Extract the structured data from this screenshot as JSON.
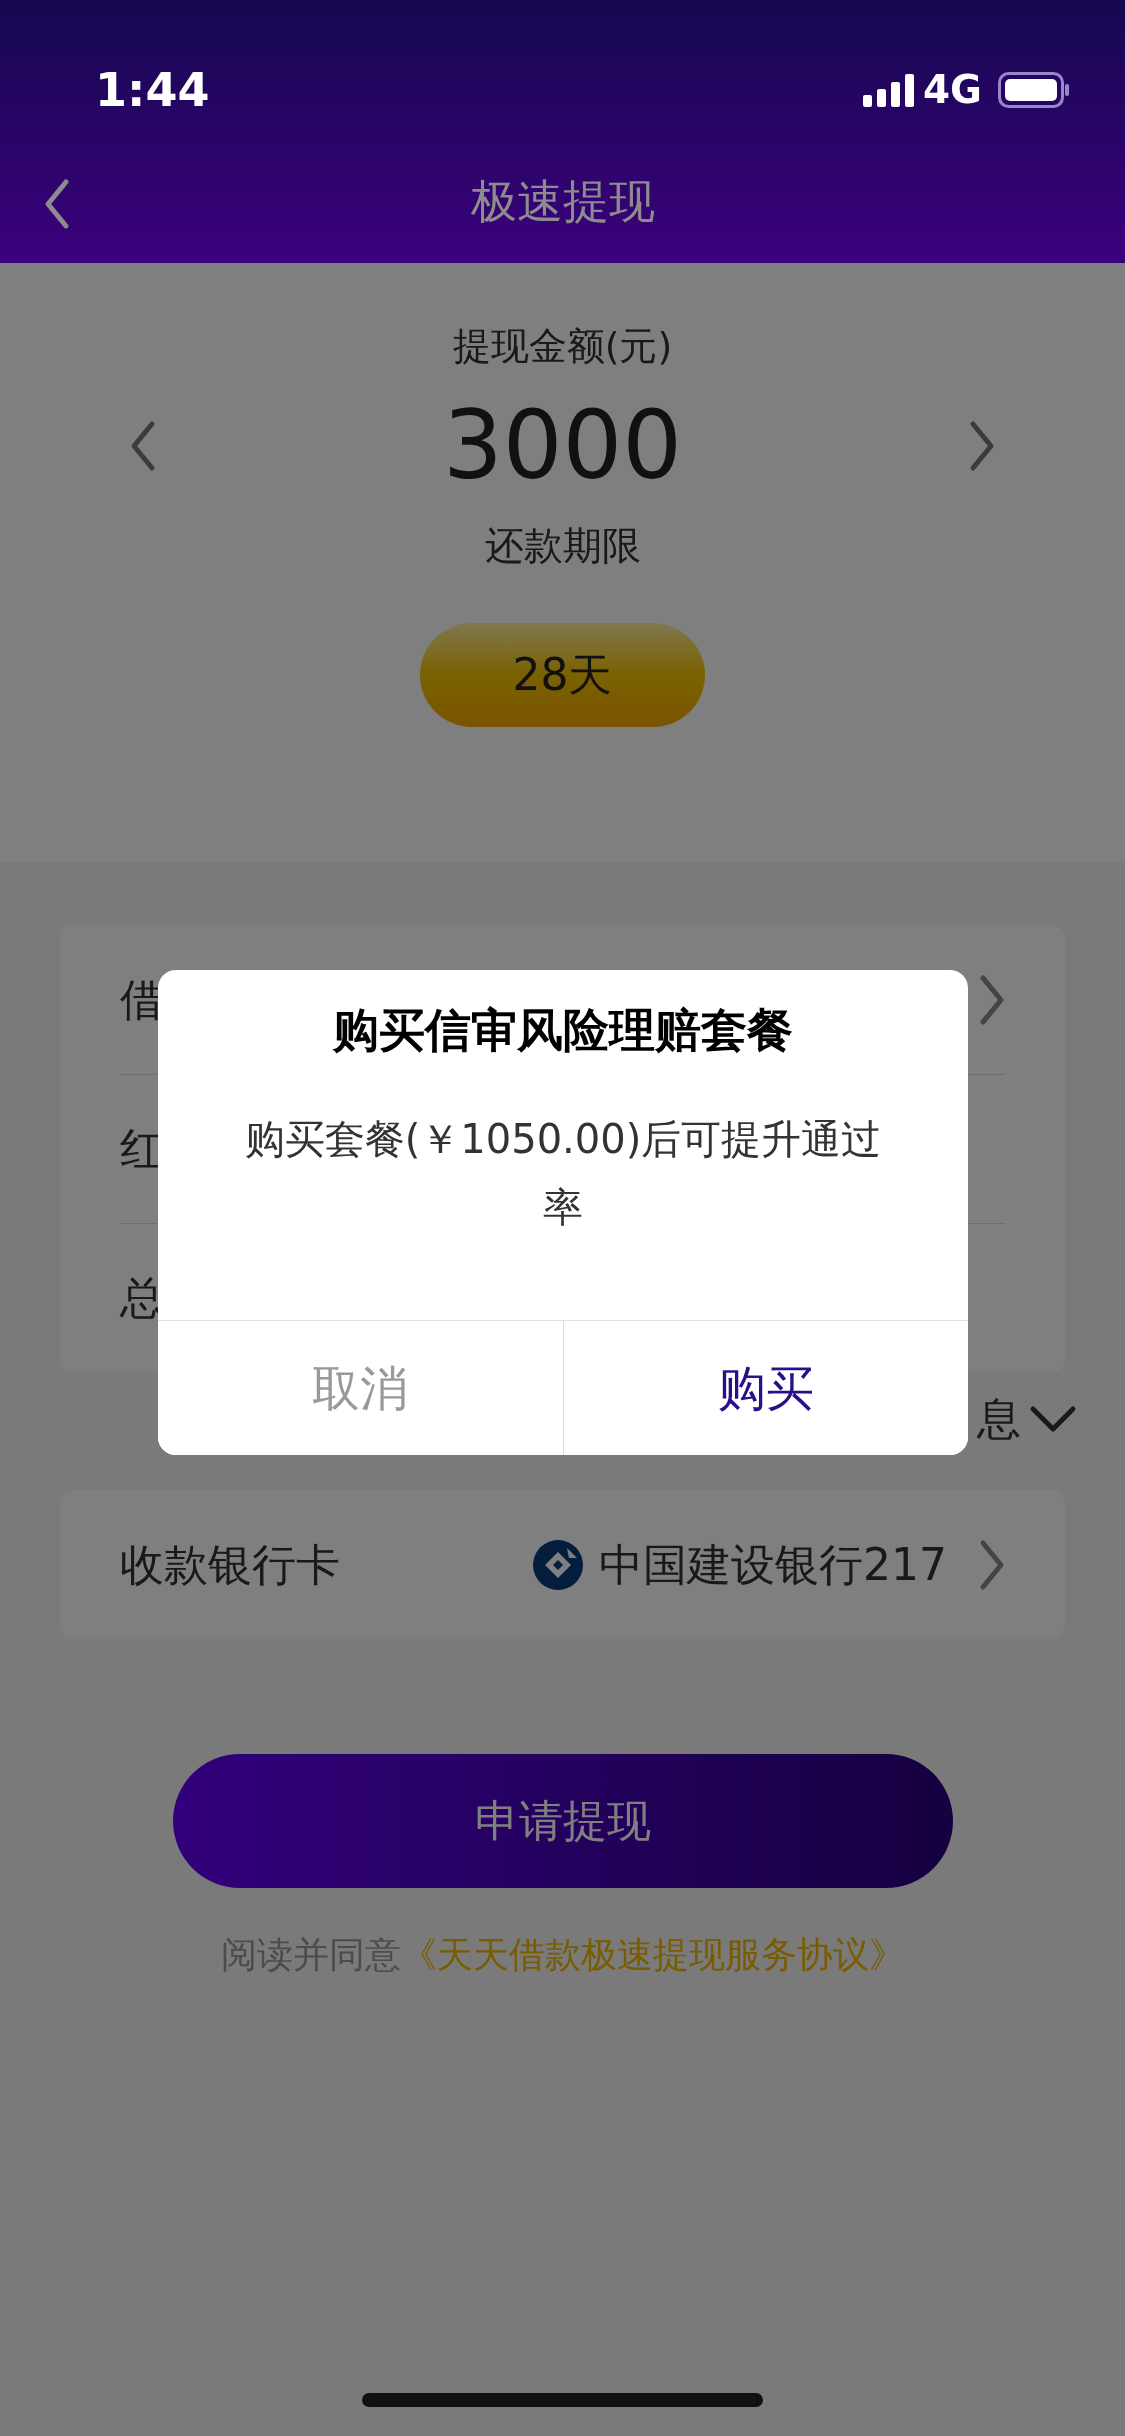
{
  "status_bar": {
    "time": "1:44",
    "network": "4G"
  },
  "nav": {
    "title": "极速提现"
  },
  "amount": {
    "label": "提现金额(元)",
    "value": "3000"
  },
  "term": {
    "label": "还款期限",
    "options": [
      {
        "label": "28天",
        "selected": true
      }
    ]
  },
  "details": {
    "rows": [
      {
        "label": "借",
        "chevron": true
      },
      {
        "label": "红",
        "chevron": false
      },
      {
        "label": "总",
        "chevron": false
      }
    ],
    "toggle": "息"
  },
  "bank": {
    "label": "收款银行卡",
    "value": "中国建设银行217"
  },
  "submit": "申请提现",
  "agreement": {
    "prefix": "阅读并同意",
    "link": "《天天借款极速提现服务协议》"
  },
  "dialog": {
    "title": "购买信审风险理赔套餐",
    "message": "购买套餐(￥1050.00)后可提升通过率",
    "buttons": [
      {
        "label": "取消",
        "kind": "cancel"
      },
      {
        "label": "购买",
        "kind": "confirm"
      }
    ]
  }
}
